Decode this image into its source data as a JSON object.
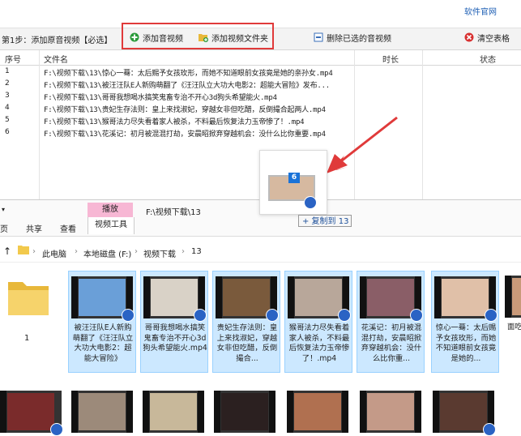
{
  "app": {
    "official_link": "软件官网",
    "step_label": "第1步：添加原音视频【必选】",
    "buttons": {
      "add_video": "添加音视频",
      "add_folder": "添加视频文件夹",
      "delete_selected": "删除已选的音视频",
      "clear_table": "清空表格"
    },
    "table": {
      "headers": [
        "序号",
        "文件名",
        "时长",
        "状态"
      ],
      "rows": [
        {
          "index": "1",
          "name": "F:\\视频下载\\13\\惊心一蓦：太后赐予女孩玫形，而她不知道眼前女孩竟是她的亲孙女.mp4"
        },
        {
          "index": "2",
          "name": "F:\\视频下载\\13\\被汪汪队E人新购萌翻了《汪汪队立大功大电影2：超能大冒险》发布..."
        },
        {
          "index": "3",
          "name": "F:\\视频下载\\13\\哥哥我想喝水搞笑鬼畜专治不开心3d狗头希望能火.mp4"
        },
        {
          "index": "4",
          "name": "F:\\视频下载\\13\\贵妃生存法则：皇上来找淑妃，穿越女非但吃醋，反倒撮合起两人.mp4"
        },
        {
          "index": "5",
          "name": "F:\\视频下载\\13\\猴哥法力尽失看着家人被杀，不料最后恢复法力玉帝惨了！.mp4"
        },
        {
          "index": "6",
          "name": "F:\\视频下载\\13\\花溪记：初月被混混打劫，安晨昭掀弃穿越机会：没什么比你重要.mp4"
        }
      ]
    }
  },
  "drag": {
    "badge_count": "6",
    "copy_tip": "+ 复制到 13"
  },
  "explorer": {
    "play_tab": "播放",
    "video_tools": "视频工具",
    "window_path": "F:\\视频下载\\13",
    "menu": [
      "页",
      "共享",
      "查看"
    ],
    "breadcrumb": [
      "此电脑",
      "本地磁盘 (F:)",
      "视频下载",
      "13"
    ],
    "folder_label": "1",
    "files": [
      {
        "caption": "被汪汪队E人新购萌翻了《汪汪队立大功大电影2：超能大冒险》",
        "color": "#6a9fd8",
        "selected": true
      },
      {
        "caption": "哥哥我想喝水搞笑鬼畜专治不开心3d狗头希望能火.mp4",
        "color": "#d9d2c7",
        "selected": true
      },
      {
        "caption": "贵妃生存法则：皇上来找淑妃，穿越女非但吃醋，反倒撮合...",
        "color": "#7a5a3c",
        "selected": true
      },
      {
        "caption": "猴哥法力尽失看着家人被杀，不料最后恢复法力玉帝惨了！.mp4",
        "color": "#b8a79a",
        "selected": true
      },
      {
        "caption": "花溪记：初月被混混打劫，安晨昭掀弃穿越机会：没什么比你重...",
        "color": "#8a5e67",
        "selected": true
      },
      {
        "caption": "惊心一蓦：太后赐予女孩玫形，而她不知道眼前女孩竟是她的...",
        "color": "#e0c0a8",
        "selected": true
      },
      {
        "caption": "面吃",
        "color": "#c99a7a",
        "selected": false
      }
    ],
    "bottom_thumbs": [
      "#7a2b2b",
      "#9c8a7a",
      "#c8b89a",
      "#2b2020",
      "#b07050",
      "#c49a88",
      "#5a3a30"
    ]
  },
  "colors": {
    "accent_red": "#e03a3a",
    "link_blue": "#1e5fb4",
    "play_tab_pink": "#f7b7d4",
    "selection_blue": "#cce8ff"
  }
}
